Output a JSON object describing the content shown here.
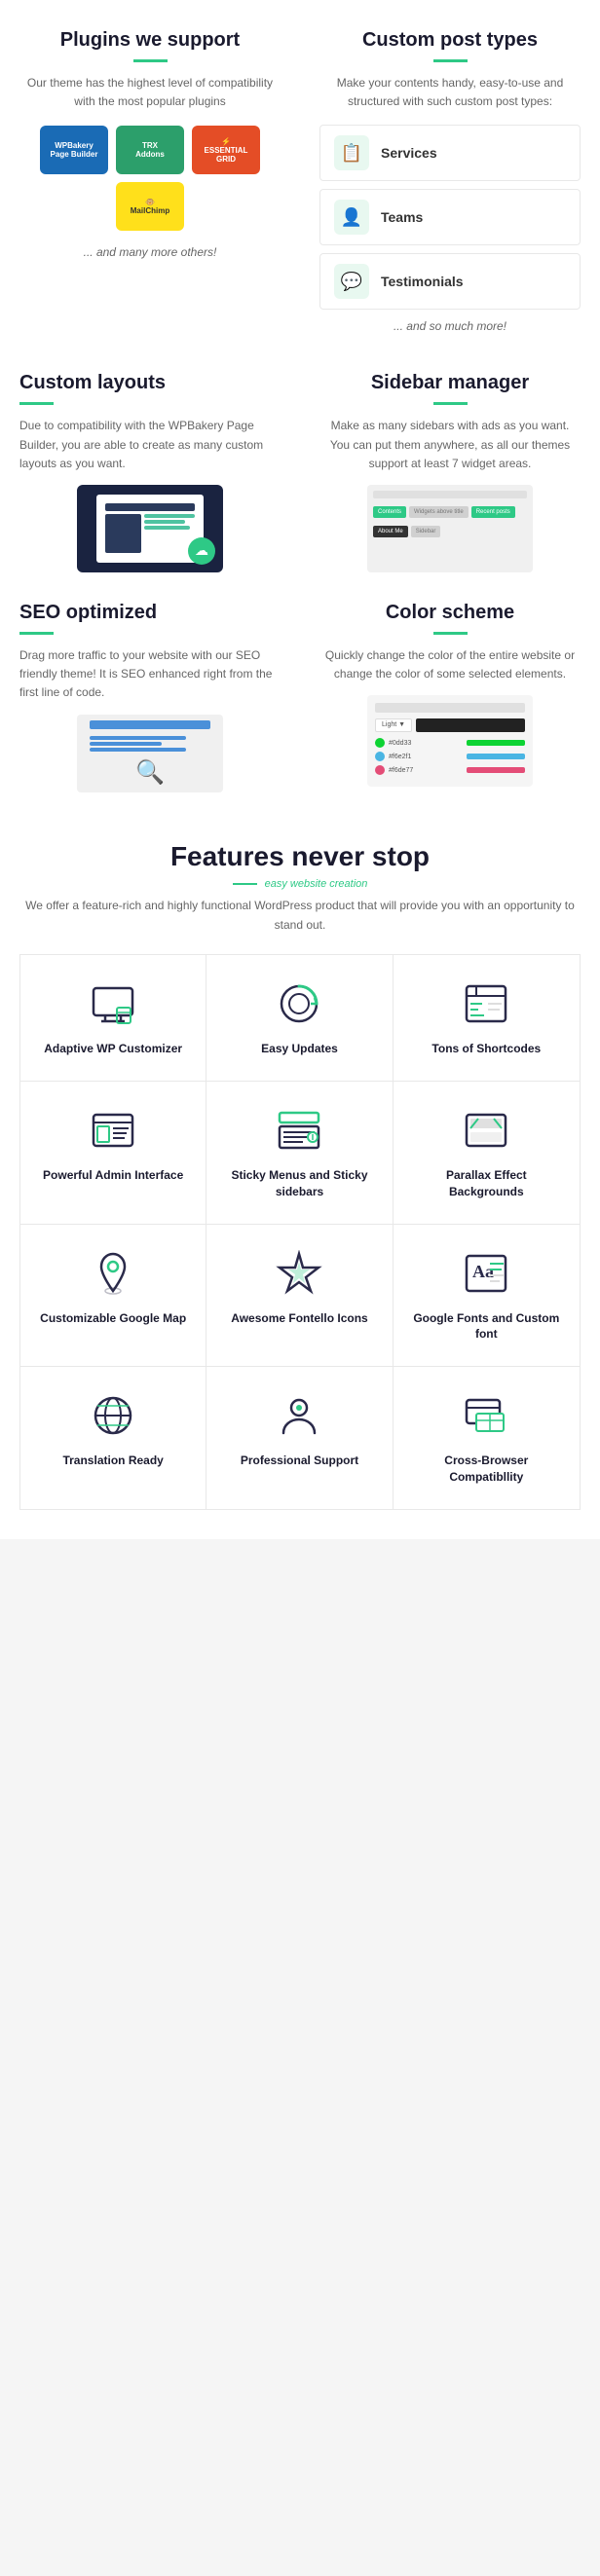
{
  "plugins": {
    "title": "Plugins we support",
    "description": "Our theme has the highest level of compatibility with the most popular plugins",
    "items": [
      {
        "name": "WPBakery\nPage Builder",
        "class": "plugin-wpbakery"
      },
      {
        "name": "TRX\nAddons",
        "class": "plugin-trx"
      },
      {
        "name": "Essential\nGrid",
        "class": "plugin-essential"
      },
      {
        "name": "MailChimp",
        "class": "plugin-mailchimp"
      }
    ],
    "and_more": "... and many more others!"
  },
  "custom_post_types": {
    "title": "Custom post types",
    "description": "Make your contents handy, easy-to-use and structured with such custom post types:",
    "items": [
      {
        "label": "Services",
        "icon": "📋"
      },
      {
        "label": "Teams",
        "icon": "👤"
      },
      {
        "label": "Testimonials",
        "icon": "💬"
      }
    ],
    "and_more": "... and so much more!"
  },
  "custom_layouts": {
    "title": "Custom layouts",
    "description": "Due to compatibility with the WPBakery Page Builder, you are able to create as many custom layouts as you want."
  },
  "sidebar_manager": {
    "title": "Sidebar manager",
    "description": "Make as many sidebars with ads as you want. You can put them anywhere, as all our themes support at least 7 widget areas."
  },
  "seo": {
    "title": "SEO optimized",
    "description": "Drag more traffic to your website with our SEO friendly theme! It is SEO enhanced right from the first line of code."
  },
  "color_scheme": {
    "title": "Color scheme",
    "description": "Quickly change the color of the entire website or change the color of some selected elements.",
    "swatches": [
      {
        "hex": "#0dd33",
        "color": "#0dd333",
        "bar": "#0dd333"
      },
      {
        "hex": "#f6e2f1",
        "color": "#4ab5e3",
        "bar": "#4ab5e3"
      },
      {
        "hex": "#f6de77",
        "color": "#e44d77",
        "bar": "#e44d77"
      }
    ]
  },
  "features": {
    "title": "Features never stop",
    "subtitle": "easy website creation",
    "description": "We offer a feature-rich and highly functional WordPress product\nthat will provide you with an opportunity to stand out.",
    "items": [
      {
        "label": "Adaptive WP\nCustomizer",
        "icon": "adaptive"
      },
      {
        "label": "Easy\nUpdates",
        "icon": "updates"
      },
      {
        "label": "Tons of\nShortcodes",
        "icon": "shortcodes"
      },
      {
        "label": "Powerful Admin\nInterface",
        "icon": "admin"
      },
      {
        "label": "Sticky Menus and\nSticky sidebars",
        "icon": "sticky"
      },
      {
        "label": "Parallax Effect\nBackgrounds",
        "icon": "parallax"
      },
      {
        "label": "Customizable\nGoogle Map",
        "icon": "map"
      },
      {
        "label": "Awesome\nFontello Icons",
        "icon": "fontello"
      },
      {
        "label": "Google Fonts and\nCustom font",
        "icon": "fonts"
      },
      {
        "label": "Translation\nReady",
        "icon": "translation"
      },
      {
        "label": "Professional\nSupport",
        "icon": "support"
      },
      {
        "label": "Cross-Browser\nCompatibllity",
        "icon": "browser"
      }
    ]
  }
}
